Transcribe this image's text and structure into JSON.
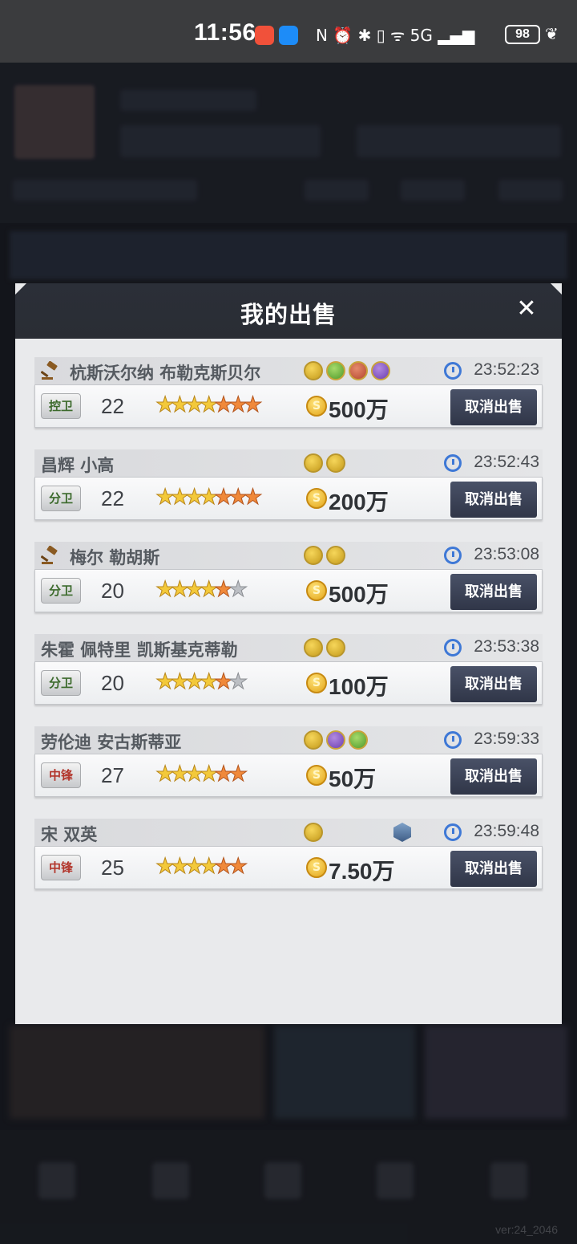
{
  "status_bar": {
    "time": "11:56",
    "indicators": "N ⏰ ✱ ▯ ᯤ 5G ▂▄▆",
    "battery": "98"
  },
  "dialog": {
    "title": "我的出售",
    "close_icon": "close-icon"
  },
  "listings": [
    {
      "name": "杭斯沃尔纳 布勒克斯贝尔",
      "auction": true,
      "badges": [
        "gold",
        "green",
        "red",
        "purple"
      ],
      "rank_badge": false,
      "time": "23:52:23",
      "position": "控卫",
      "position_type": "guard",
      "level": "22",
      "stars": {
        "filled_yellow": 4,
        "filled_orange": 3,
        "empty": 0
      },
      "price": "500万",
      "cancel_label": "取消出售"
    },
    {
      "name": "昌辉 小高",
      "auction": false,
      "badges": [
        "gold",
        "gold"
      ],
      "rank_badge": false,
      "time": "23:52:43",
      "position": "分卫",
      "position_type": "guard",
      "level": "22",
      "stars": {
        "filled_yellow": 4,
        "filled_orange": 3,
        "empty": 0
      },
      "price": "200万",
      "cancel_label": "取消出售"
    },
    {
      "name": "梅尔 勒胡斯",
      "auction": true,
      "badges": [
        "gold",
        "gold"
      ],
      "rank_badge": false,
      "time": "23:53:08",
      "position": "分卫",
      "position_type": "guard",
      "level": "20",
      "stars": {
        "filled_yellow": 4,
        "filled_orange": 1,
        "empty": 1
      },
      "price": "500万",
      "cancel_label": "取消出售"
    },
    {
      "name": "朱霍 佩特里 凯斯基克蒂勒",
      "auction": false,
      "badges": [
        "gold",
        "gold"
      ],
      "rank_badge": false,
      "time": "23:53:38",
      "position": "分卫",
      "position_type": "guard",
      "level": "20",
      "stars": {
        "filled_yellow": 4,
        "filled_orange": 1,
        "empty": 1
      },
      "price": "100万",
      "cancel_label": "取消出售"
    },
    {
      "name": "劳伦迪 安古斯蒂亚",
      "auction": false,
      "badges": [
        "gold",
        "purple",
        "green"
      ],
      "rank_badge": false,
      "time": "23:59:33",
      "position": "中锋",
      "position_type": "center",
      "level": "27",
      "stars": {
        "filled_yellow": 4,
        "filled_orange": 2,
        "empty": 0
      },
      "price": "50万",
      "cancel_label": "取消出售"
    },
    {
      "name": "宋 双英",
      "auction": false,
      "badges": [
        "gold"
      ],
      "rank_badge": true,
      "time": "23:59:48",
      "position": "中锋",
      "position_type": "center",
      "level": "25",
      "stars": {
        "filled_yellow": 4,
        "filled_orange": 2,
        "empty": 0
      },
      "price": "7.50万",
      "cancel_label": "取消出售"
    }
  ],
  "footer": {
    "version": "ver:24_2046"
  }
}
